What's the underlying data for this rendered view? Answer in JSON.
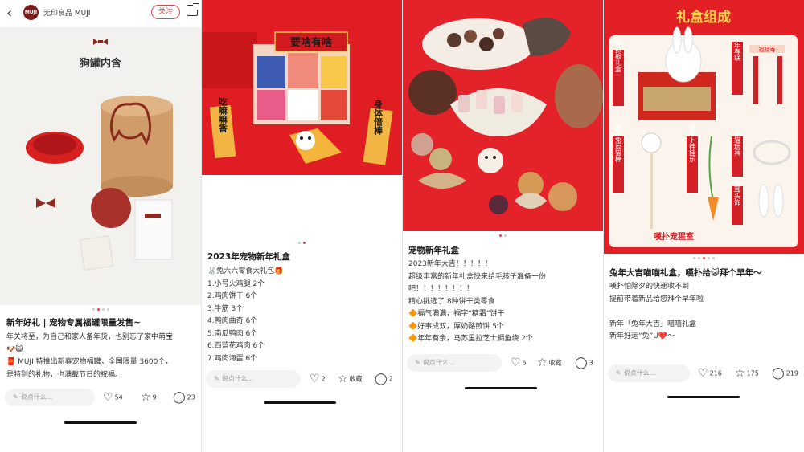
{
  "panels": [
    {
      "header": {
        "back_glyph": "‹",
        "avatar_text": "MUJI",
        "brand": "无印良品 MUJI",
        "follow_label": "关注"
      },
      "image": {
        "caption_title": "狗罐内含",
        "icon": "dog-bone-icon"
      },
      "dots": {
        "count": 4,
        "active": 1
      },
      "title": "新年好礼 | 宠物专属福罐限量发售~",
      "body": [
        "年关将至，为自己和家人备年货，也别忘了家中萌宝",
        "🐶😸",
        "🧧 MUJI 特推出新春宠物福罐，全国限量 3600个，",
        "是特别的礼物，也满载节日的祝福。"
      ],
      "comment_placeholder": "说点什么...",
      "actions": {
        "like": "54",
        "star": "9",
        "comment": "23"
      }
    },
    {
      "image": {
        "sign_1": "要啥有啥",
        "sign_2": "吃嘛嘛香",
        "sign_3": "身体倍棒"
      },
      "dots": {
        "count": 2,
        "active": 1
      },
      "title": "2023年宠物新年礼盒",
      "body": [
        "🐰兔六六零食大礼包🎁",
        "1.小号火鸡腿 2个",
        "2.鸡肉饼干 6个",
        "3.牛筋 3个",
        "4.鸭肉曲奇 6个",
        "5.南瓜鸭肉 6个",
        "6.西蓝花鸡肉 6个",
        "7.鸡肉海蛋 6个"
      ],
      "comment_placeholder": "说点什么...",
      "actions": {
        "like": "2",
        "star": "收藏",
        "comment": "2"
      }
    },
    {
      "image": {},
      "dots": {
        "count": 2,
        "active": 0
      },
      "title": "宠物新年礼盒",
      "body": [
        "2023新年大吉！！！！！",
        "超级丰富的新年礼盒快来给毛孩子准备一份",
        "吧！！！！！！！！",
        "精心挑选了 8种饼干类零食",
        "🔶福气满满，福字“糖霜”饼干",
        "🔶好事成双，厚奶酪煎饼 5个",
        "🔶年年有余，马苏里拉芝士鲷鱼烧 2个"
      ],
      "comment_placeholder": "说点什么...",
      "actions": {
        "like": "5",
        "star": "收藏",
        "comment": "3"
      }
    },
    {
      "image": {
        "banner": "礼盒组成",
        "label_1": "猫抓板礼盒",
        "label_2": "兔年春联",
        "label_3": "福禄寿",
        "label_4": "蹦迪兔逗猫棒",
        "label_5": "福萝卜挂挂乐",
        "label_6": "兔猫玩具",
        "label_7": "兔耳头饰",
        "brand": "嘆扑宠猩室"
      },
      "dots": {
        "count": 5,
        "active": 2
      },
      "title": "兔年大吉喵喵礼盒，嘆扑给😺拜个早年～",
      "body": [
        "嘆扑怕除夕的快递收不到",
        "提前带着新品给您拜个早年啦",
        "",
        "新年「兔年大吉」喵喵礼盒",
        "新年好运“兔”U❤️～"
      ],
      "comment_placeholder": "说点什么...",
      "actions": {
        "like": "216",
        "star": "175",
        "comment": "219"
      }
    }
  ],
  "colors": {
    "accent": "#e5424d",
    "festive_red": "#e31f26"
  }
}
